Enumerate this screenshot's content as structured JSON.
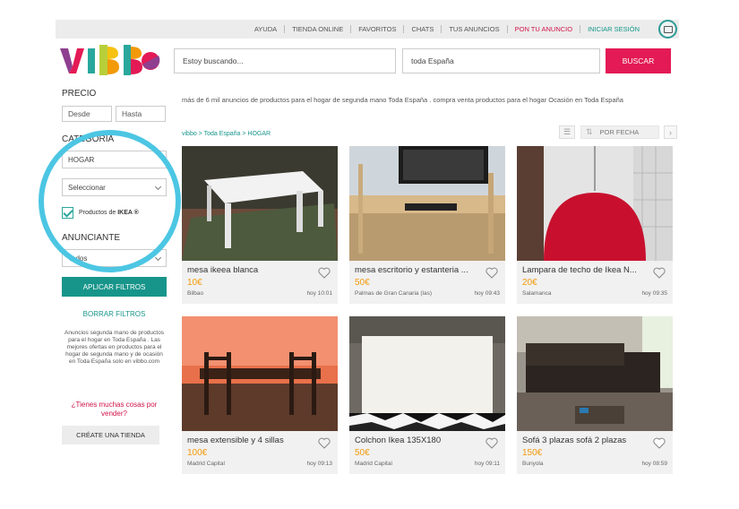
{
  "topnav": {
    "items": [
      "AYUDA",
      "TIENDA ONLINE",
      "FAVORITOS",
      "CHATS",
      "TUS ANUNCIOS",
      "PON TU ANUNCIO",
      "INICIAR SESIÓN"
    ]
  },
  "brand": {
    "logo_text": "vibbo"
  },
  "search": {
    "query": "Estoy buscando...",
    "location": "toda España",
    "button": "BUSCAR"
  },
  "sidebar": {
    "price_title": "PRECIO",
    "price_from": "Desde",
    "price_to": "Hasta",
    "category_title": "CATEGORÍA",
    "category_value": "HOGAR",
    "subcategory_value": "Seleccionar",
    "ikea_prefix": "Productos de ",
    "ikea_brand": "IKEA ®",
    "advertiser_title": "ANUNCIANTE",
    "advertiser_value": "Todos",
    "apply_label": "APLICAR FILTROS",
    "clear_label": "BORRAR FILTROS",
    "description": "Anuncios segunda mano de productos para el hogar en Toda España . Las mejores ofertas en productos para el hogar de segunda mano y de ocasión en Toda España solo en vibbo.com",
    "many_things": "¿Tienes muchas cosas por vender?",
    "create_store": "CRÉATE UNA TIENDA"
  },
  "main": {
    "intro": "más de 6 mil anuncios de productos para el hogar de segunda mano Toda España . compra venta productos para el hogar Ocasión en Toda España",
    "breadcrumb": "vibbo > Toda España > HOGAR",
    "sort_label": "POR FECHA",
    "listings": [
      {
        "title": "mesa ikeea blanca",
        "price": "10€",
        "location": "Bilbao",
        "time": "hoy 10:01"
      },
      {
        "title": "mesa escritorio y estanteria ...",
        "price": "50€",
        "location": "Palmas de Gran Canaria (las)",
        "time": "hoy 09:43"
      },
      {
        "title": "Lampara de techo de Ikea N...",
        "price": "20€",
        "location": "Salamanca",
        "time": "hoy 09:35"
      },
      {
        "title": "mesa extensible y 4 sillas",
        "price": "100€",
        "location": "Madrid Capital",
        "time": "hoy 09:13"
      },
      {
        "title": "Colchon Ikea 135X180",
        "price": "50€",
        "location": "Madrid Capital",
        "time": "hoy 09:11"
      },
      {
        "title": "Sofá 3 plazas sofá 2 plazas",
        "price": "150€",
        "location": "Bunyola",
        "time": "hoy 08:59"
      }
    ]
  },
  "colors": {
    "brand_red": "#e31a55",
    "teal": "#17958a",
    "price_orange": "#f29a0a",
    "highlight": "#4cc6e3"
  }
}
